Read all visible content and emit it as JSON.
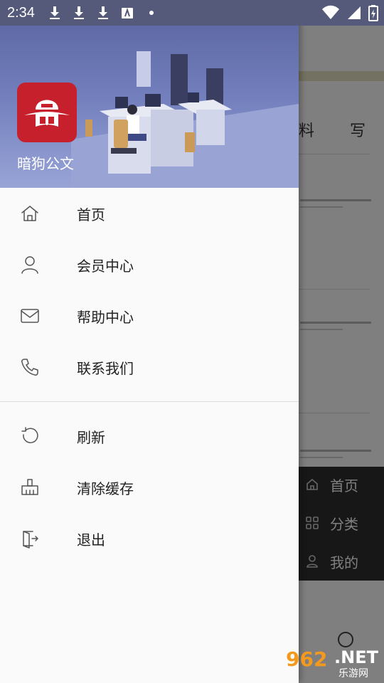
{
  "status_bar": {
    "time": "2:34",
    "icons": [
      "download-icon",
      "download-icon",
      "download-icon",
      "a-badge-icon",
      "dot-icon"
    ],
    "right_icons": [
      "wifi-icon",
      "signal-icon",
      "battery-icon"
    ]
  },
  "drawer": {
    "app_name": "暗狗公文",
    "menu": [
      {
        "label": "首页",
        "icon": "home-icon"
      },
      {
        "label": "会员中心",
        "icon": "user-icon"
      },
      {
        "label": "帮助中心",
        "icon": "mail-icon"
      },
      {
        "label": "联系我们",
        "icon": "phone-icon"
      }
    ],
    "menu2": [
      {
        "label": "刷新",
        "icon": "refresh-icon"
      },
      {
        "label": "清除缓存",
        "icon": "broom-icon"
      },
      {
        "label": "退出",
        "icon": "exit-icon"
      }
    ]
  },
  "background": {
    "tabs": [
      "料",
      "写"
    ],
    "popup": [
      {
        "label": "首页",
        "icon": "home-icon"
      },
      {
        "label": "分类",
        "icon": "grid-icon"
      },
      {
        "label": "我的",
        "icon": "person-icon"
      }
    ]
  },
  "watermark": {
    "number": "962",
    "suffix": ".NET",
    "chinese": "乐游网"
  }
}
